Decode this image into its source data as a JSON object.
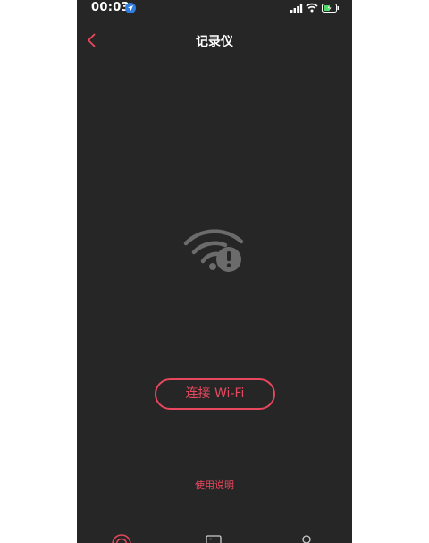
{
  "status_bar": {
    "time": "00:03",
    "icons": [
      "location-arrow-icon",
      "signal-bars-icon",
      "wifi-icon",
      "battery-charging-icon"
    ]
  },
  "nav": {
    "back_icon": "chevron-left-icon",
    "title": "记录仪"
  },
  "main": {
    "status_icon": "wifi-warning-icon",
    "connect_button_label": "连接 Wi-Fi",
    "help_link_label": "使用说明"
  },
  "tab_bar": {
    "icons": [
      "recorder-tab-icon",
      "album-tab-icon",
      "profile-tab-icon"
    ]
  },
  "colors": {
    "background": "#262626",
    "accent": "#e8475d",
    "icon_gray": "#6b6b6b",
    "text": "#ffffff"
  }
}
